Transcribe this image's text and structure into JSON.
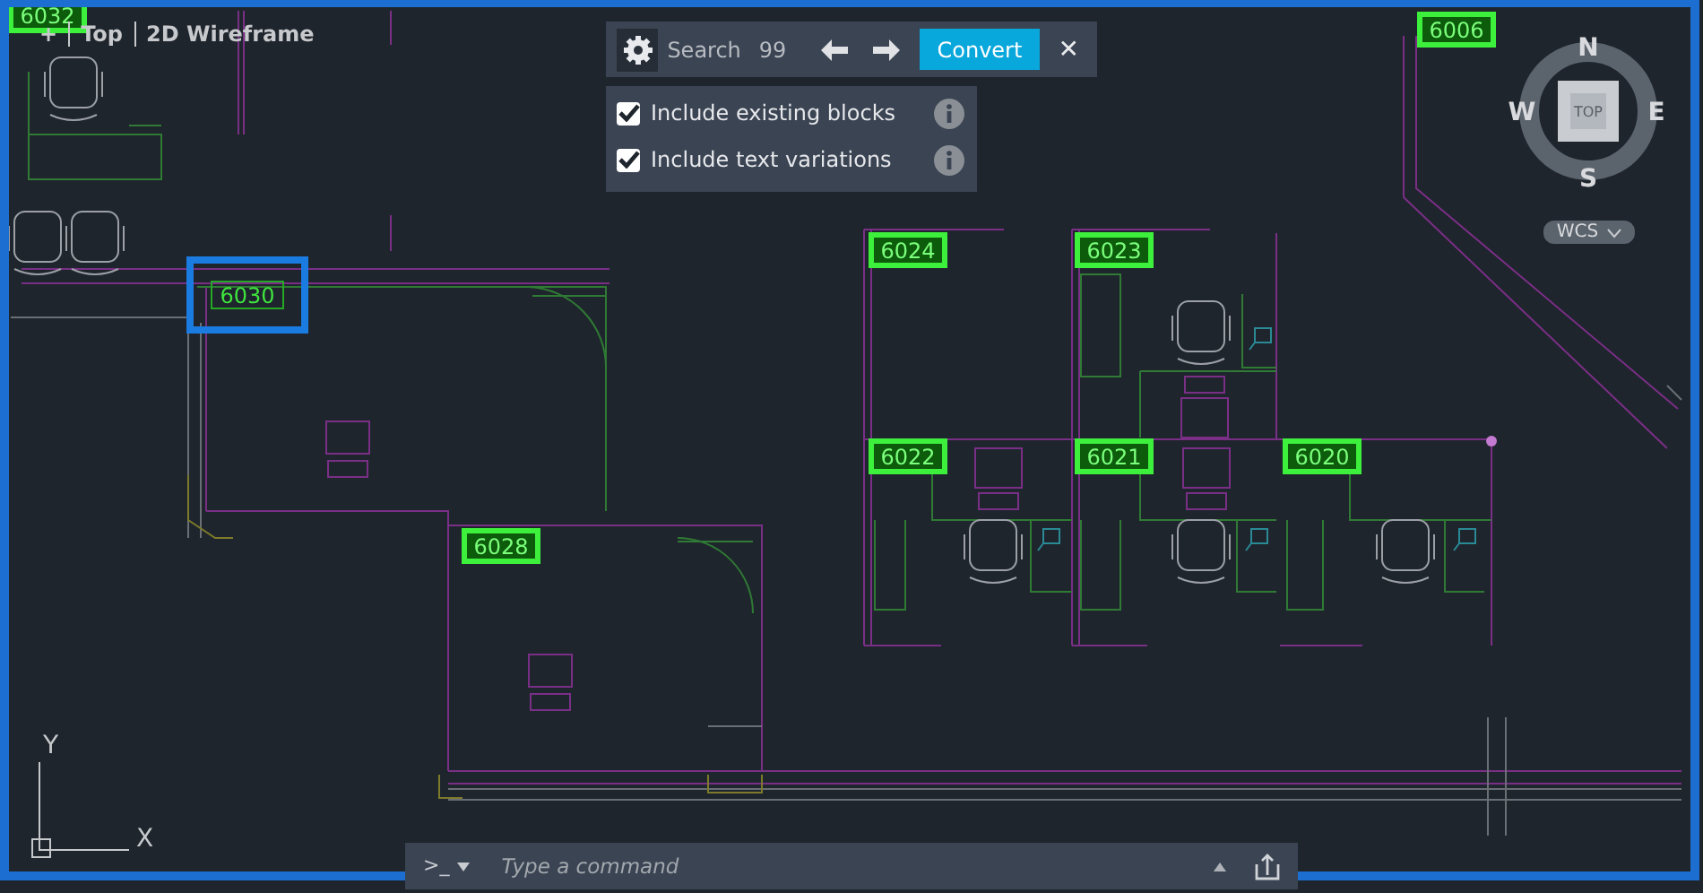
{
  "viewport_controls": {
    "menu": "+",
    "view": "Top",
    "visual_style": "2D Wireframe"
  },
  "room_labels": [
    {
      "text": "6032",
      "selected": false
    },
    {
      "text": "6006",
      "selected": false
    },
    {
      "text": "6030",
      "selected": true
    },
    {
      "text": "6024",
      "selected": false
    },
    {
      "text": "6023",
      "selected": false
    },
    {
      "text": "6022",
      "selected": false
    },
    {
      "text": "6021",
      "selected": false
    },
    {
      "text": "6020",
      "selected": false
    },
    {
      "text": "6028",
      "selected": false
    }
  ],
  "search_toolbar": {
    "label": "Search",
    "count": "99",
    "convert": "Convert",
    "close": "✕",
    "options": [
      {
        "label": "Include existing blocks",
        "checked": true
      },
      {
        "label": "Include text variations",
        "checked": true
      }
    ]
  },
  "viewcube": {
    "north": "N",
    "south": "S",
    "east": "E",
    "west": "W",
    "face": "TOP",
    "coordinate_system": "WCS"
  },
  "ucs": {
    "y": "Y",
    "x": "X"
  },
  "command_line": {
    "prompt": ">_",
    "placeholder": "Type a command"
  }
}
